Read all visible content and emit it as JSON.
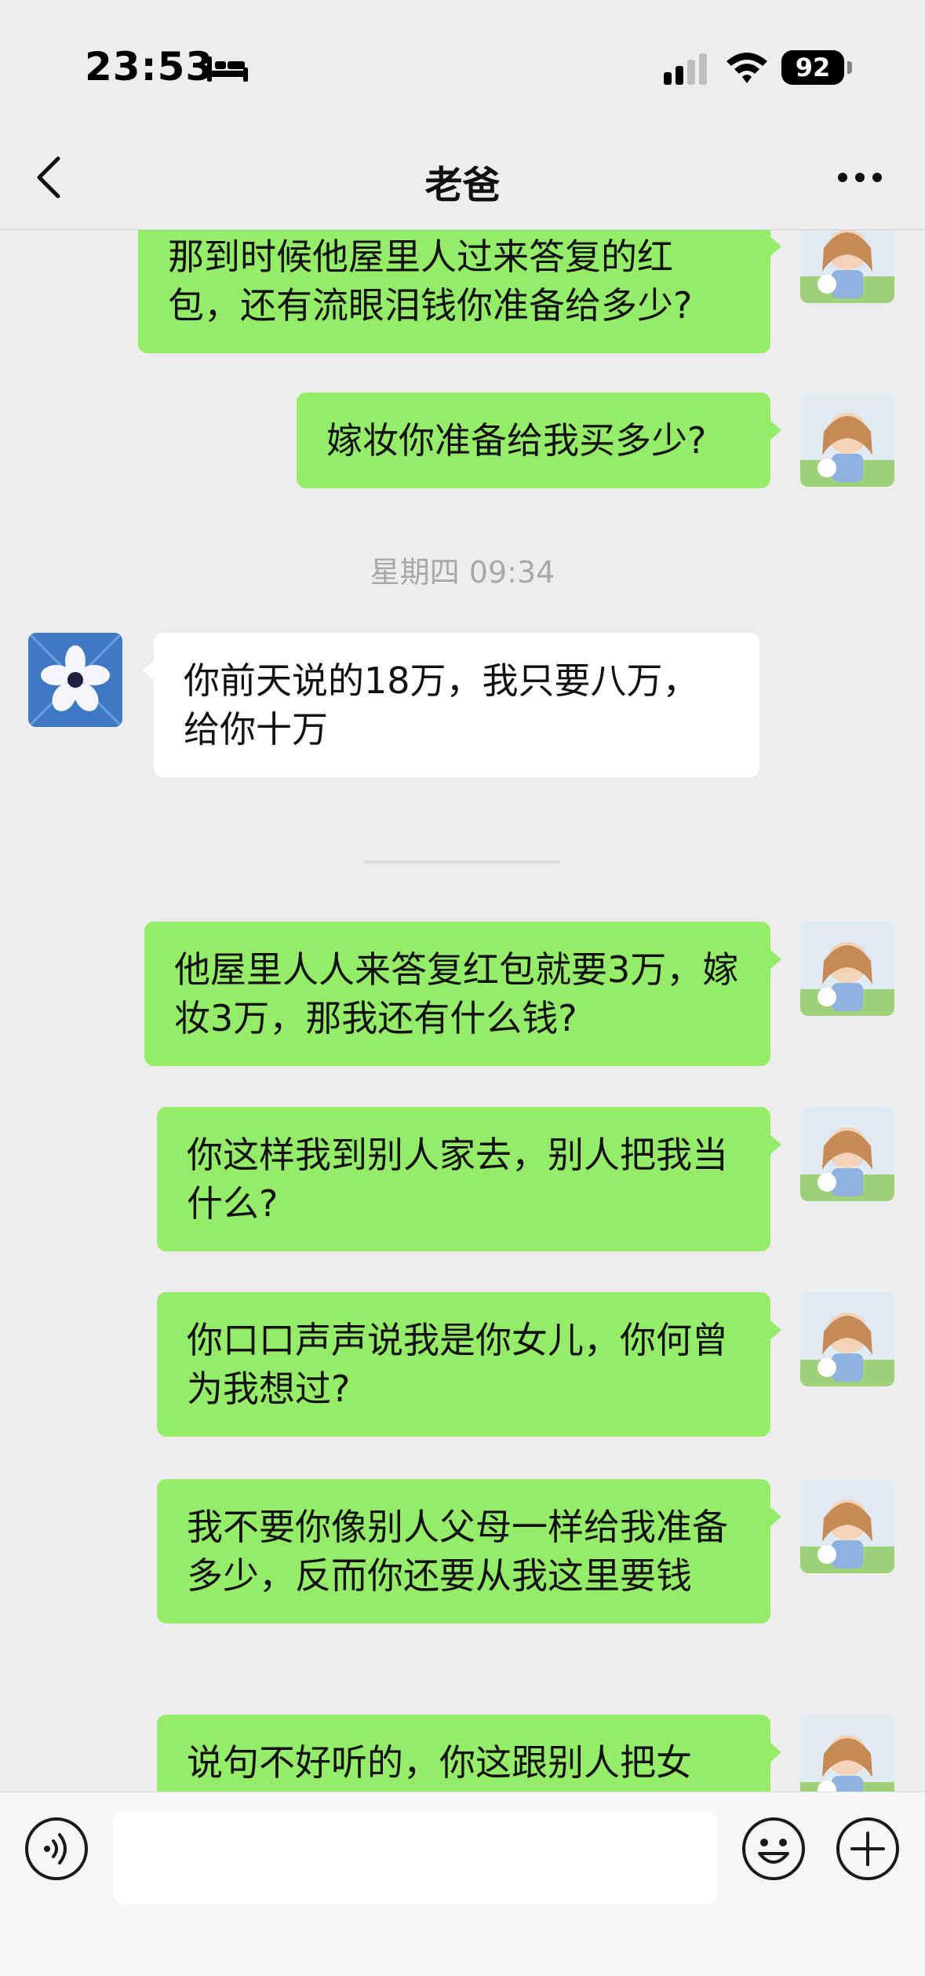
{
  "status_bar": {
    "time": "23:53",
    "battery": "92"
  },
  "header": {
    "title": "老爸"
  },
  "messages": [
    {
      "side": "out",
      "text": "那到时候他屋里人过来答复的红包，还有流眼泪钱你准备给多少?"
    },
    {
      "side": "out",
      "text": "嫁妆你准备给我买多少?"
    },
    {
      "side": "in",
      "text": "你前天说的18万，我只要八万，给你十万"
    },
    {
      "side": "out",
      "text": "他屋里人人来答复红包就要3万，嫁妆3万，那我还有什么钱?"
    },
    {
      "side": "out",
      "text": "你这样我到别人家去，别人把我当什么?"
    },
    {
      "side": "out",
      "text": "你口口声声说我是你女儿，你何曾为我想过?"
    },
    {
      "side": "out",
      "text": "我不要你像别人父母一样给我准备多少，反而你还要从我这里要钱"
    },
    {
      "side": "out",
      "text": "说句不好听的，你这跟别人把女"
    }
  ],
  "timestamp": "星期四 09:34",
  "colors": {
    "outgoing_bubble": "#95ec69",
    "incoming_bubble": "#ffffff",
    "background": "#ededed"
  },
  "icons": [
    "bed-icon",
    "signal-icon",
    "wifi-icon",
    "back-icon",
    "more-icon",
    "voice-icon",
    "emoji-icon",
    "plus-icon"
  ]
}
